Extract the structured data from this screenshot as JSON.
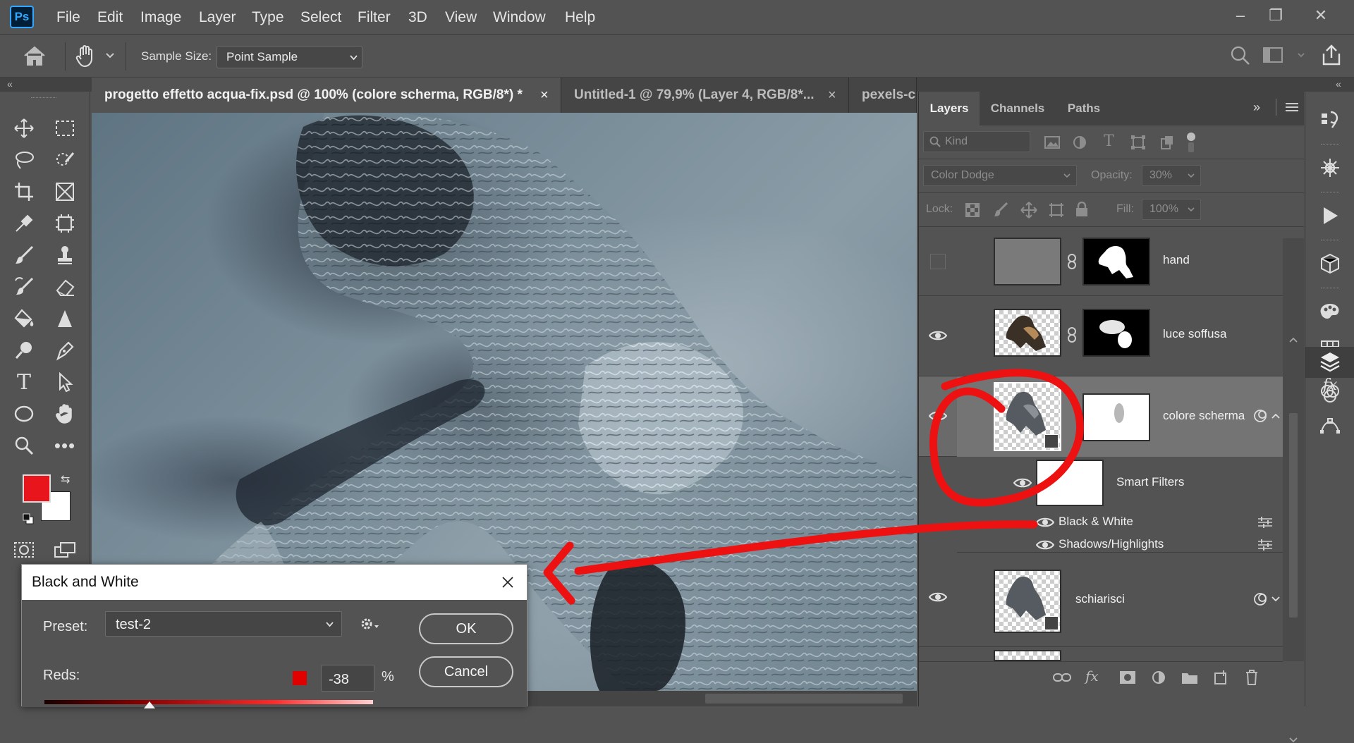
{
  "app": {
    "logo": "Ps"
  },
  "menu": [
    "File",
    "Edit",
    "Image",
    "Layer",
    "Type",
    "Select",
    "Filter",
    "3D",
    "View",
    "Window",
    "Help"
  ],
  "window_controls": {
    "minimize": "–",
    "restore": "❐",
    "close": "✕"
  },
  "options_bar": {
    "sample_size_label": "Sample Size:",
    "sample_size_value": "Point Sample"
  },
  "doc_tabs": [
    {
      "title": "progetto effetto acqua-fix.psd @ 100% (colore scherma, RGB/8*) *",
      "close": "×"
    },
    {
      "title": "Untitled-1 @ 79,9% (Layer 4, RGB/8*...",
      "close": "×"
    },
    {
      "title": "pexels-c"
    }
  ],
  "panel_tabs": [
    "Layers",
    "Channels",
    "Paths"
  ],
  "layers_panel": {
    "filter_kind": "Kind",
    "blend_mode": "Color Dodge",
    "opacity_label": "Opacity:",
    "opacity_value": "30%",
    "lock_label": "Lock:",
    "fill_label": "Fill:",
    "fill_value": "100%",
    "layers": [
      {
        "name": "hand",
        "visible": false
      },
      {
        "name": "luce soffusa",
        "visible": true
      },
      {
        "name": "colore scherma",
        "visible": true,
        "selected": true
      },
      {
        "name": "schiarisci",
        "visible": true
      }
    ],
    "smart_filters_label": "Smart Filters",
    "smart_filters": [
      "Black & White",
      "Shadows/Highlights"
    ]
  },
  "dialog": {
    "title": "Black and White",
    "preset_label": "Preset:",
    "preset_value": "test-2",
    "ok_label": "OK",
    "cancel_label": "Cancel",
    "reds_label": "Reds:",
    "reds_value": "-38",
    "percent": "%",
    "reds_color": "#e00000",
    "reds_slider_position": 0.32
  },
  "colors": {
    "foreground": "#e8161c",
    "background": "#ffffff",
    "annotation": "#ee1111",
    "accent": "#31a8ff"
  }
}
